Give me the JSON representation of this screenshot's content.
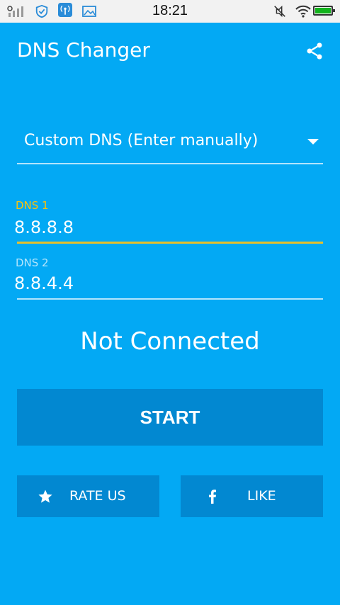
{
  "statusbar": {
    "time": "18:21"
  },
  "appbar": {
    "title": "DNS Changer",
    "share_icon": "share-icon"
  },
  "dns_selector": {
    "selected": "Custom DNS (Enter manually)"
  },
  "dns1": {
    "label": "DNS 1",
    "value": "8.8.8.8"
  },
  "dns2": {
    "label": "DNS 2",
    "value": "8.8.4.4"
  },
  "connection_status": "Not Connected",
  "buttons": {
    "start": "START",
    "rate_us": "RATE US",
    "like": "LIKE"
  },
  "colors": {
    "background": "#03A9F4",
    "button": "#0288D1",
    "focus_accent": "#E7C02B"
  }
}
